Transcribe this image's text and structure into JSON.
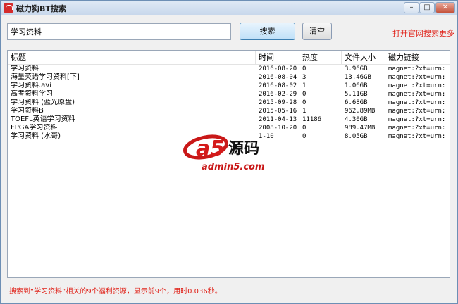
{
  "window": {
    "title": "磁力狗BT搜索"
  },
  "search": {
    "query": "学习资料",
    "search_label": "搜索",
    "clear_label": "清空",
    "open_web_label": "打开官网搜索更多"
  },
  "table": {
    "columns": [
      "标题",
      "时间",
      "热度",
      "文件大小",
      "磁力链接"
    ],
    "rows": [
      [
        "学习资料",
        "2016-08-20",
        "0",
        "3.96GB",
        "magnet:?xt=urn:..."
      ],
      [
        "海量英语学习资料[下]",
        "2016-08-04",
        "3",
        "13.46GB",
        "magnet:?xt=urn:..."
      ],
      [
        "学习资料.avi",
        "2016-08-02",
        "1",
        "1.06GB",
        "magnet:?xt=urn:..."
      ],
      [
        "高考资料学习",
        "2016-02-29",
        "0",
        "5.11GB",
        "magnet:?xt=urn:..."
      ],
      [
        "学习资料 (蓝光原盘)",
        "2015-09-28",
        "0",
        "6.68GB",
        "magnet:?xt=urn:..."
      ],
      [
        "学习资料B",
        "2015-05-16",
        "1",
        "962.89MB",
        "magnet:?xt=urn:..."
      ],
      [
        "TOEFL英语学习资料",
        "2011-04-13",
        "11186",
        "4.30GB",
        "magnet:?xt=urn:..."
      ],
      [
        "FPGA学习资料",
        "2008-10-20",
        "0",
        "989.47MB",
        "magnet:?xt=urn:..."
      ],
      [
        "学习资料 (水哥)",
        "1-10",
        "0",
        "8.05GB",
        "magnet:?xt=urn:..."
      ]
    ]
  },
  "watermark": {
    "logo": "a5源码",
    "domain": "admin5.com"
  },
  "status": {
    "text": "搜索到“学习资料”相关的9个福利资源，显示前9个，用时0.036秒。"
  },
  "colors": {
    "accent_red": "#e0231a",
    "title_bar": "#c8d8ec"
  }
}
